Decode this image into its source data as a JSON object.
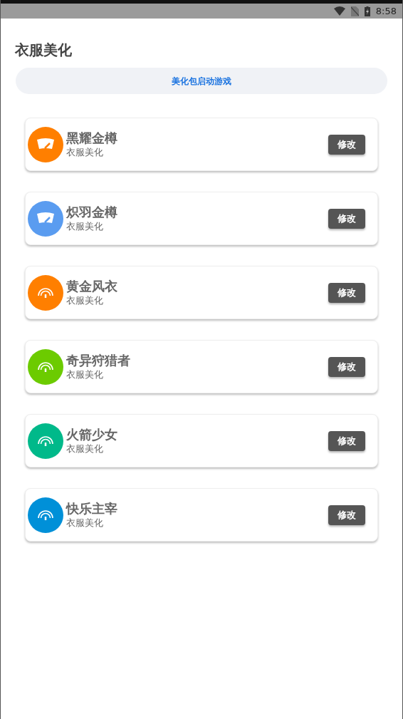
{
  "status_bar": {
    "time": "8:58"
  },
  "title": "衣服美化",
  "launch_button": "美化包启动游戏",
  "items": [
    {
      "name": "黑耀金樽",
      "subtitle": "衣服美化",
      "button": "修改",
      "kind": "windshield",
      "color": "#ff7f00"
    },
    {
      "name": "炽羽金樽",
      "subtitle": "衣服美化",
      "button": "修改",
      "kind": "windshield",
      "color": "#5a9cf0"
    },
    {
      "name": "黄金风衣",
      "subtitle": "衣服美化",
      "button": "修改",
      "kind": "gauge",
      "color": "#ff7f00"
    },
    {
      "name": "奇异狩猎者",
      "subtitle": "衣服美化",
      "button": "修改",
      "kind": "gauge",
      "color": "#6ccb00"
    },
    {
      "name": "火箭少女",
      "subtitle": "衣服美化",
      "button": "修改",
      "kind": "gauge",
      "color": "#00b98a"
    },
    {
      "name": "快乐主宰",
      "subtitle": "衣服美化",
      "button": "修改",
      "kind": "gauge",
      "color": "#0090d8"
    }
  ]
}
